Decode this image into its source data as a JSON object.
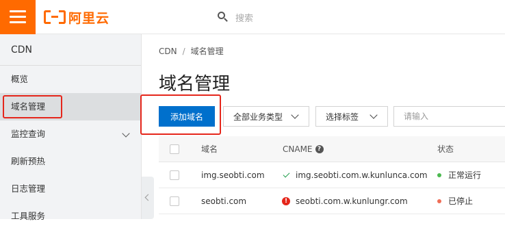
{
  "header": {
    "brand": "阿里云",
    "search_placeholder": "搜索"
  },
  "sidebar": {
    "title": "CDN",
    "items": [
      {
        "label": "概览"
      },
      {
        "label": "域名管理",
        "active": true
      },
      {
        "label": "监控查询",
        "has_submenu": true
      },
      {
        "label": "刷新预热"
      },
      {
        "label": "日志管理"
      },
      {
        "label": "工具服务"
      }
    ]
  },
  "breadcrumb": {
    "root": "CDN",
    "separator": "/",
    "current": "域名管理"
  },
  "page": {
    "title": "域名管理"
  },
  "toolbar": {
    "add_domain_label": "添加域名",
    "business_type_label": "全部业务类型",
    "tag_select_label": "选择标签",
    "search_placeholder": "请输入"
  },
  "table": {
    "columns": {
      "domain": "域名",
      "cname": "CNAME",
      "status": "状态"
    },
    "rows": [
      {
        "domain": "img.seobti.com",
        "cname": "img.seobti.com.w.kunlunca.com",
        "cname_state": "ok",
        "status": "正常运行",
        "status_color": "#4cb950"
      },
      {
        "domain": "seobti.com",
        "cname": "seobti.com.w.kunlungr.com",
        "cname_state": "error",
        "status": "已停止",
        "status_color": "#ef6e57"
      }
    ]
  },
  "colors": {
    "brand": "#ff6a00",
    "primary": "#0070cc",
    "highlight": "#e5261b"
  }
}
